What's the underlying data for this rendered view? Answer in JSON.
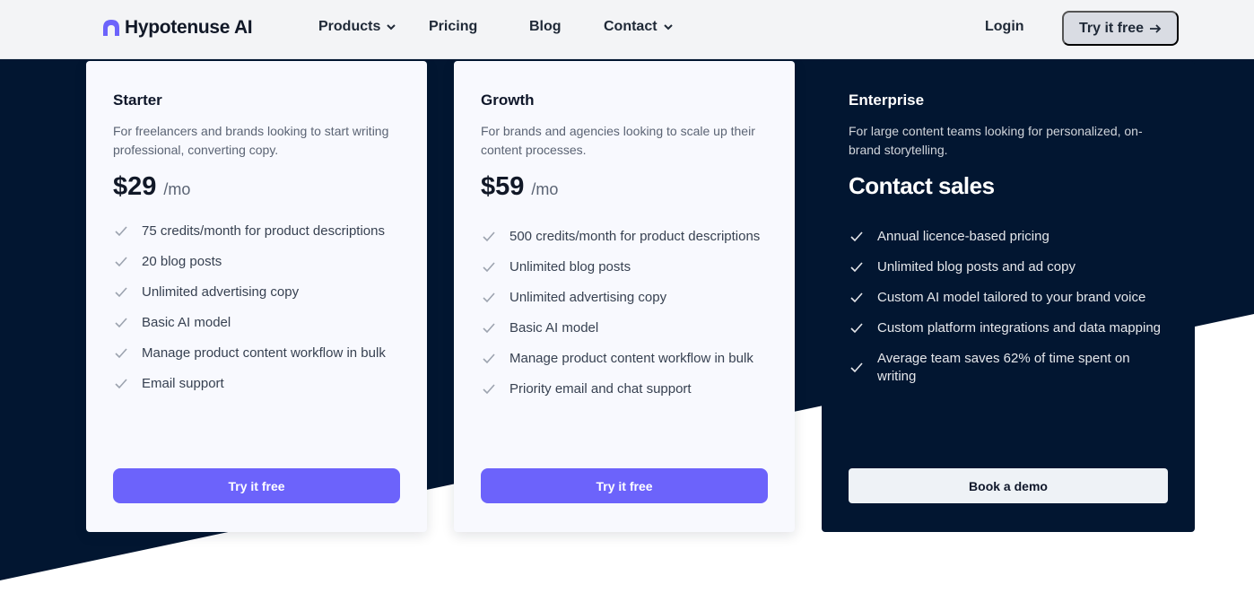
{
  "nav": {
    "brand": "Hypotenuse AI",
    "items": [
      {
        "label": "Products",
        "has_dropdown": true
      },
      {
        "label": "Pricing",
        "has_dropdown": false
      },
      {
        "label": "Blog",
        "has_dropdown": false
      },
      {
        "label": "Contact",
        "has_dropdown": true
      }
    ],
    "login": "Login",
    "try_free": "Try it free",
    "try_free_icon": "arrow-right-icon"
  },
  "plans": [
    {
      "name": "Starter",
      "description": "For freelancers and brands looking to start writing professional, converting copy.",
      "price": "$29",
      "unit": "/mo",
      "features": [
        "75 credits/month for product descriptions",
        "20 blog posts",
        "Unlimited advertising copy",
        "Basic AI model",
        "Manage product content workflow in bulk",
        "Email support"
      ],
      "cta": "Try it free"
    },
    {
      "name": "Growth",
      "description": "For brands and agencies looking to scale up their content processes.",
      "price": "$59",
      "unit": "/mo",
      "features": [
        "500 credits/month for product descriptions",
        "Unlimited blog posts",
        "Unlimited advertising copy",
        "Basic AI model",
        "Manage product content workflow in bulk",
        "Priority email and chat support"
      ],
      "cta": "Try it free"
    },
    {
      "name": "Enterprise",
      "description": "For large content teams looking for personalized, on-brand storytelling.",
      "price_text": "Contact sales",
      "features": [
        "Annual licence-based pricing",
        "Unlimited blog posts and ad copy",
        "Custom AI model tailored to your brand voice",
        "Custom platform integrations and data mapping",
        "Average team saves 62% of time spent on writing"
      ],
      "cta": "Book a demo"
    }
  ],
  "colors": {
    "accent": "#6c63fb",
    "dark_band": "#021631",
    "nav_bg": "#f3f4f6"
  }
}
